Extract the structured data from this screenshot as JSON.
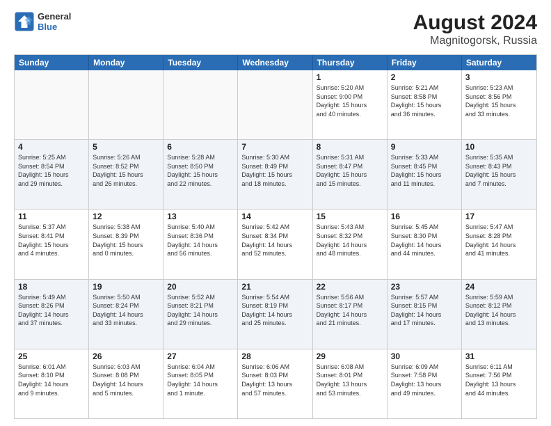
{
  "header": {
    "logo_line1": "General",
    "logo_line2": "Blue",
    "title": "August 2024",
    "subtitle": "Magnitogorsk, Russia"
  },
  "calendar": {
    "days_of_week": [
      "Sunday",
      "Monday",
      "Tuesday",
      "Wednesday",
      "Thursday",
      "Friday",
      "Saturday"
    ],
    "rows": [
      [
        {
          "day": "",
          "empty": true
        },
        {
          "day": "",
          "empty": true
        },
        {
          "day": "",
          "empty": true
        },
        {
          "day": "",
          "empty": true
        },
        {
          "day": "1",
          "info": "Sunrise: 5:20 AM\nSunset: 9:00 PM\nDaylight: 15 hours\nand 40 minutes."
        },
        {
          "day": "2",
          "info": "Sunrise: 5:21 AM\nSunset: 8:58 PM\nDaylight: 15 hours\nand 36 minutes."
        },
        {
          "day": "3",
          "info": "Sunrise: 5:23 AM\nSunset: 8:56 PM\nDaylight: 15 hours\nand 33 minutes."
        }
      ],
      [
        {
          "day": "4",
          "info": "Sunrise: 5:25 AM\nSunset: 8:54 PM\nDaylight: 15 hours\nand 29 minutes."
        },
        {
          "day": "5",
          "info": "Sunrise: 5:26 AM\nSunset: 8:52 PM\nDaylight: 15 hours\nand 26 minutes."
        },
        {
          "day": "6",
          "info": "Sunrise: 5:28 AM\nSunset: 8:50 PM\nDaylight: 15 hours\nand 22 minutes."
        },
        {
          "day": "7",
          "info": "Sunrise: 5:30 AM\nSunset: 8:49 PM\nDaylight: 15 hours\nand 18 minutes."
        },
        {
          "day": "8",
          "info": "Sunrise: 5:31 AM\nSunset: 8:47 PM\nDaylight: 15 hours\nand 15 minutes."
        },
        {
          "day": "9",
          "info": "Sunrise: 5:33 AM\nSunset: 8:45 PM\nDaylight: 15 hours\nand 11 minutes."
        },
        {
          "day": "10",
          "info": "Sunrise: 5:35 AM\nSunset: 8:43 PM\nDaylight: 15 hours\nand 7 minutes."
        }
      ],
      [
        {
          "day": "11",
          "info": "Sunrise: 5:37 AM\nSunset: 8:41 PM\nDaylight: 15 hours\nand 4 minutes."
        },
        {
          "day": "12",
          "info": "Sunrise: 5:38 AM\nSunset: 8:39 PM\nDaylight: 15 hours\nand 0 minutes."
        },
        {
          "day": "13",
          "info": "Sunrise: 5:40 AM\nSunset: 8:36 PM\nDaylight: 14 hours\nand 56 minutes."
        },
        {
          "day": "14",
          "info": "Sunrise: 5:42 AM\nSunset: 8:34 PM\nDaylight: 14 hours\nand 52 minutes."
        },
        {
          "day": "15",
          "info": "Sunrise: 5:43 AM\nSunset: 8:32 PM\nDaylight: 14 hours\nand 48 minutes."
        },
        {
          "day": "16",
          "info": "Sunrise: 5:45 AM\nSunset: 8:30 PM\nDaylight: 14 hours\nand 44 minutes."
        },
        {
          "day": "17",
          "info": "Sunrise: 5:47 AM\nSunset: 8:28 PM\nDaylight: 14 hours\nand 41 minutes."
        }
      ],
      [
        {
          "day": "18",
          "info": "Sunrise: 5:49 AM\nSunset: 8:26 PM\nDaylight: 14 hours\nand 37 minutes."
        },
        {
          "day": "19",
          "info": "Sunrise: 5:50 AM\nSunset: 8:24 PM\nDaylight: 14 hours\nand 33 minutes."
        },
        {
          "day": "20",
          "info": "Sunrise: 5:52 AM\nSunset: 8:21 PM\nDaylight: 14 hours\nand 29 minutes."
        },
        {
          "day": "21",
          "info": "Sunrise: 5:54 AM\nSunset: 8:19 PM\nDaylight: 14 hours\nand 25 minutes."
        },
        {
          "day": "22",
          "info": "Sunrise: 5:56 AM\nSunset: 8:17 PM\nDaylight: 14 hours\nand 21 minutes."
        },
        {
          "day": "23",
          "info": "Sunrise: 5:57 AM\nSunset: 8:15 PM\nDaylight: 14 hours\nand 17 minutes."
        },
        {
          "day": "24",
          "info": "Sunrise: 5:59 AM\nSunset: 8:12 PM\nDaylight: 14 hours\nand 13 minutes."
        }
      ],
      [
        {
          "day": "25",
          "info": "Sunrise: 6:01 AM\nSunset: 8:10 PM\nDaylight: 14 hours\nand 9 minutes."
        },
        {
          "day": "26",
          "info": "Sunrise: 6:03 AM\nSunset: 8:08 PM\nDaylight: 14 hours\nand 5 minutes."
        },
        {
          "day": "27",
          "info": "Sunrise: 6:04 AM\nSunset: 8:05 PM\nDaylight: 14 hours\nand 1 minute."
        },
        {
          "day": "28",
          "info": "Sunrise: 6:06 AM\nSunset: 8:03 PM\nDaylight: 13 hours\nand 57 minutes."
        },
        {
          "day": "29",
          "info": "Sunrise: 6:08 AM\nSunset: 8:01 PM\nDaylight: 13 hours\nand 53 minutes."
        },
        {
          "day": "30",
          "info": "Sunrise: 6:09 AM\nSunset: 7:58 PM\nDaylight: 13 hours\nand 49 minutes."
        },
        {
          "day": "31",
          "info": "Sunrise: 6:11 AM\nSunset: 7:56 PM\nDaylight: 13 hours\nand 44 minutes."
        }
      ]
    ]
  }
}
